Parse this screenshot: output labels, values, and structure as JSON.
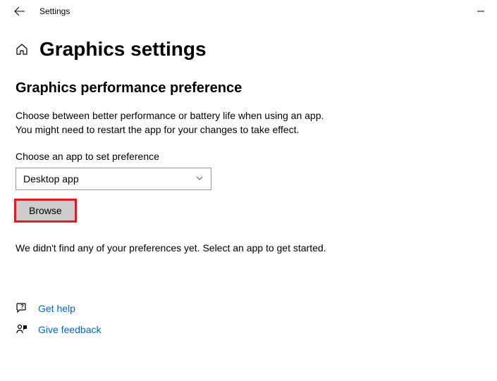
{
  "titlebar": {
    "title": "Settings"
  },
  "page": {
    "title": "Graphics settings"
  },
  "section": {
    "title": "Graphics performance preference",
    "desc_line1": "Choose between better performance or battery life when using an app.",
    "desc_line2": "You might need to restart the app for your changes to take effect.",
    "dropdown_label": "Choose an app to set preference",
    "dropdown_value": "Desktop app",
    "browse_label": "Browse",
    "not_found": "We didn't find any of your preferences yet. Select an app to get started."
  },
  "footer": {
    "help_label": "Get help",
    "feedback_label": "Give feedback"
  }
}
